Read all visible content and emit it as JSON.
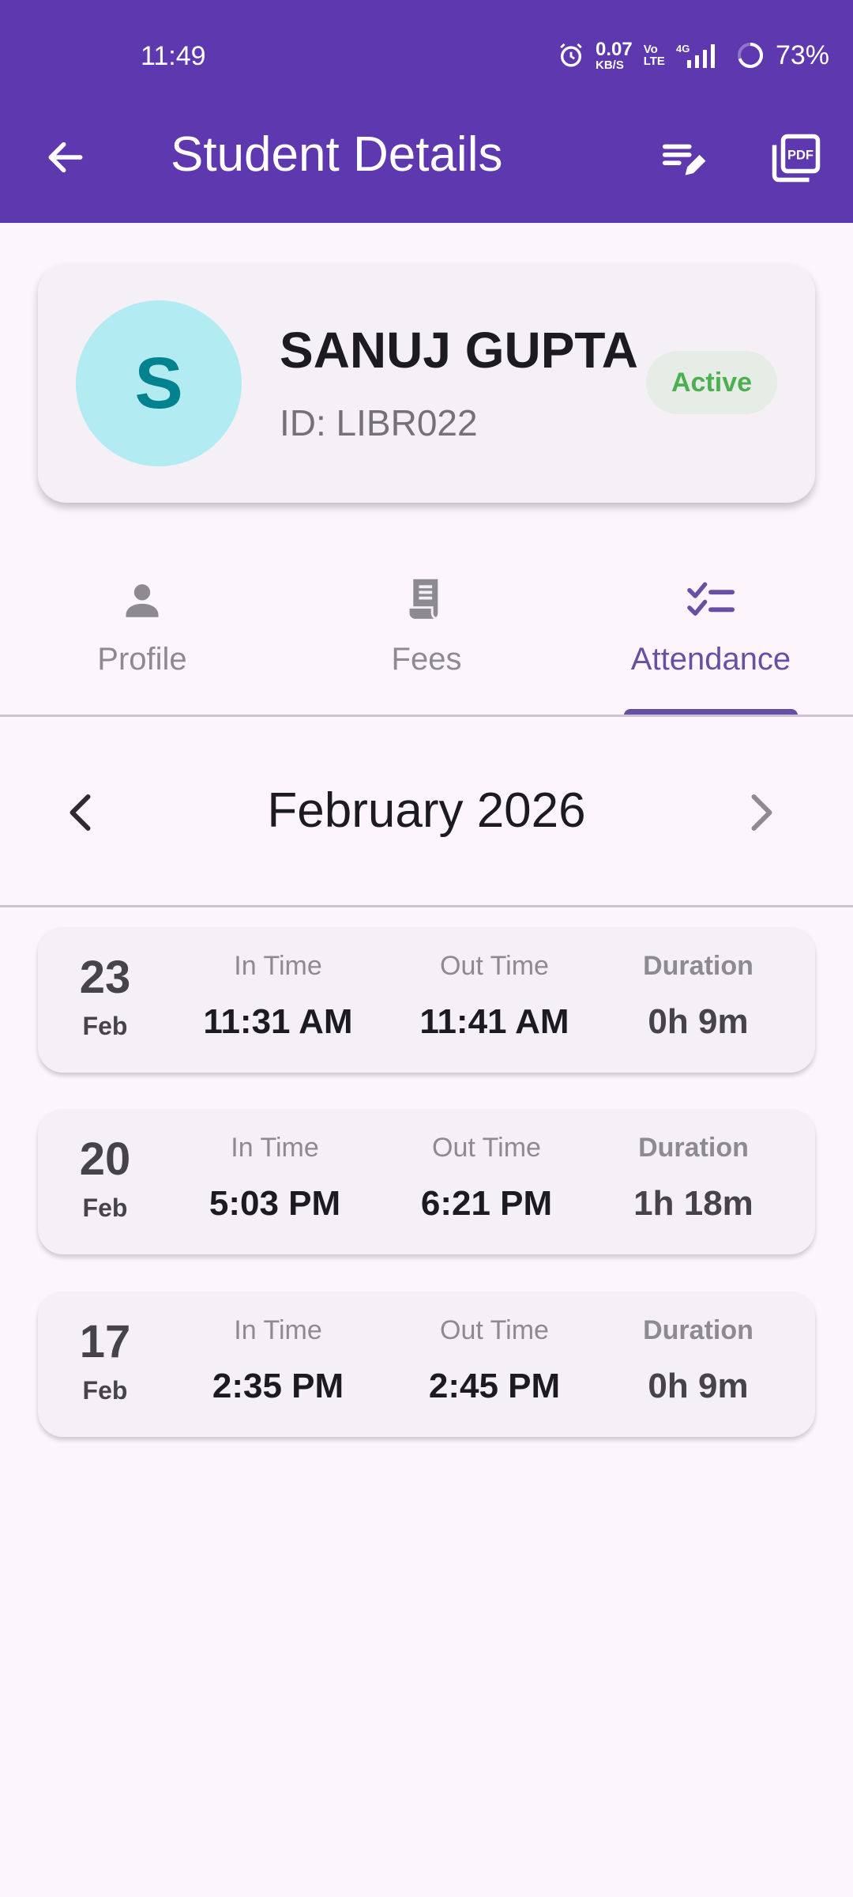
{
  "status_bar": {
    "time": "11:49",
    "net_speed_value": "0.07",
    "net_speed_unit": "KB/S",
    "volte_top": "Vo",
    "volte_bottom": "LTE",
    "network": "4G",
    "battery": "73%"
  },
  "app_bar": {
    "title": "Student Details"
  },
  "student": {
    "initial": "S",
    "name": "SANUJ GUPTA",
    "id_text": "ID: LIBR022",
    "status": "Active"
  },
  "tabs": [
    {
      "label": "Profile",
      "icon": "person-icon"
    },
    {
      "label": "Fees",
      "icon": "receipt-icon"
    },
    {
      "label": "Attendance",
      "icon": "checklist-icon",
      "active": true
    }
  ],
  "month_nav": {
    "label": "February 2026"
  },
  "attendance": [
    {
      "day": "23",
      "month": "Feb",
      "in_label": "In Time",
      "in_time": "11:31 AM",
      "out_label": "Out Time",
      "out_time": "11:41 AM",
      "duration_label": "Duration",
      "duration": "0h 9m"
    },
    {
      "day": "20",
      "month": "Feb",
      "in_label": "In Time",
      "in_time": "5:03 PM",
      "out_label": "Out Time",
      "out_time": "6:21 PM",
      "duration_label": "Duration",
      "duration": "1h 18m"
    },
    {
      "day": "17",
      "month": "Feb",
      "in_label": "In Time",
      "in_time": "2:35 PM",
      "out_label": "Out Time",
      "out_time": "2:45 PM",
      "duration_label": "Duration",
      "duration": "0h 9m"
    }
  ],
  "colors": {
    "primary": "#5E38AF",
    "accent": "#6750A4",
    "avatar_bg": "#B3EBF2",
    "avatar_text": "#00838F",
    "active_green": "#4CAF50"
  }
}
